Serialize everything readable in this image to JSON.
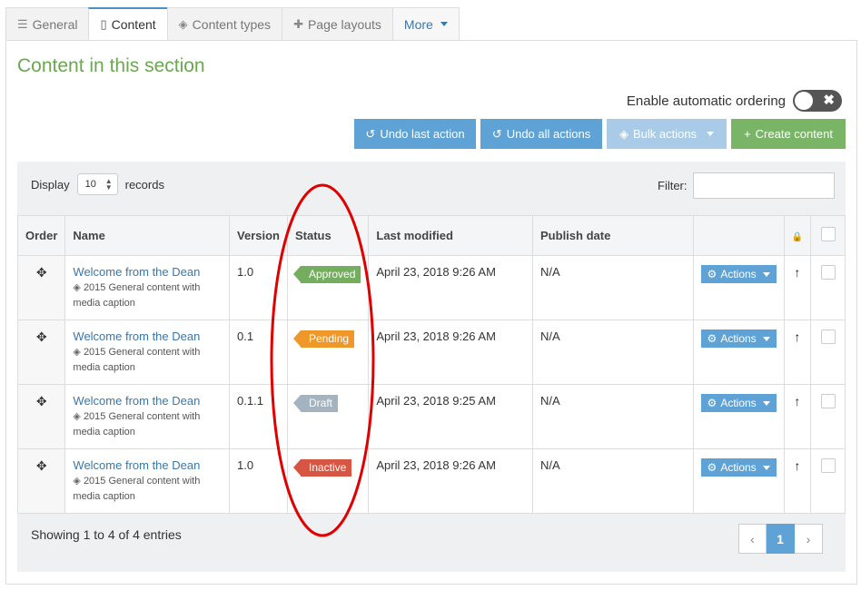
{
  "tabs": [
    {
      "label": "General",
      "icon": "sliders-icon"
    },
    {
      "label": "Content",
      "icon": "document-icon"
    },
    {
      "label": "Content types",
      "icon": "cubes-icon"
    },
    {
      "label": "Page layouts",
      "icon": "puzzle-icon"
    },
    {
      "label": "More",
      "icon": "chevron-down-icon"
    }
  ],
  "section_title": "Content in this section",
  "auto_ordering": {
    "label": "Enable automatic ordering",
    "enabled": false
  },
  "buttons": {
    "undo_last": "Undo last action",
    "undo_all": "Undo all actions",
    "bulk": "Bulk actions",
    "create": "Create content"
  },
  "display": {
    "prefix": "Display",
    "value": "10",
    "suffix": "records"
  },
  "filter": {
    "label": "Filter:",
    "value": ""
  },
  "columns": [
    "Order",
    "Name",
    "Version",
    "Status",
    "Last modified",
    "Publish date",
    "",
    "",
    ""
  ],
  "rows": [
    {
      "name": "Welcome from the Dean",
      "type": "2015 General content with",
      "type2": "media caption",
      "version": "1.0",
      "status": "Approved",
      "modified": "April 23, 2018 9:26 AM",
      "publish": "N/A",
      "action": "Actions"
    },
    {
      "name": "Welcome from the Dean",
      "type": "2015 General content with",
      "type2": "media caption",
      "version": "0.1",
      "status": "Pending",
      "modified": "April 23, 2018 9:26 AM",
      "publish": "N/A",
      "action": "Actions"
    },
    {
      "name": "Welcome from the Dean",
      "type": "2015 General content with",
      "type2": "media caption",
      "version": "0.1.1",
      "status": "Draft",
      "modified": "April 23, 2018 9:25 AM",
      "publish": "N/A",
      "action": "Actions"
    },
    {
      "name": "Welcome from the Dean",
      "type": "2015 General content with",
      "type2": "media caption",
      "version": "1.0",
      "status": "Inactive",
      "modified": "April 23, 2018 9:26 AM",
      "publish": "N/A",
      "action": "Actions"
    }
  ],
  "footer": {
    "showing": "Showing 1 to 4 of 4 entries"
  },
  "pagination": {
    "prev": "‹",
    "current": "1",
    "next": "›"
  },
  "colors": {
    "accent": "#5fa3d6",
    "green": "#74ad5e",
    "orange": "#f0972a",
    "gray": "#a4b3c0",
    "red": "#d65643",
    "annotation": "#e00000"
  }
}
